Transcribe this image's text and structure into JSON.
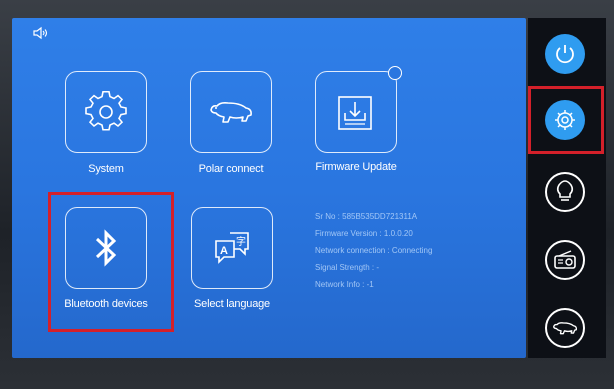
{
  "tiles": {
    "system": {
      "label": "System",
      "icon": "gear-icon"
    },
    "polar_connect": {
      "label": "Polar connect",
      "icon": "polar-bear-icon"
    },
    "firmware_update": {
      "label": "Firmware Update",
      "icon": "download-icon"
    },
    "bluetooth_devices": {
      "label": "Bluetooth devices",
      "icon": "bluetooth-icon"
    },
    "select_language": {
      "label": "Select language",
      "icon": "language-icon"
    }
  },
  "info": {
    "serial": "Sr No : 585B535DD721311A",
    "firmware_version": "Firmware Version : 1.0.0.20",
    "network_connection": "Network connection : Connecting",
    "signal_strength": "Signal Strength : -",
    "network_info": "Network Info :   -1"
  },
  "sidebar": {
    "items": [
      {
        "icon": "power-icon",
        "active": true
      },
      {
        "icon": "gear-icon",
        "active": true,
        "selected": true
      },
      {
        "icon": "lightbulb-icon",
        "active": false
      },
      {
        "icon": "radio-icon",
        "active": false
      },
      {
        "icon": "polar-bear-icon",
        "active": false
      }
    ]
  },
  "colors": {
    "screen": "#2a76e0",
    "highlight": "#d4202a",
    "sidebar_active": "#2f9cf0",
    "sidebar_bg": "#0d1016"
  }
}
